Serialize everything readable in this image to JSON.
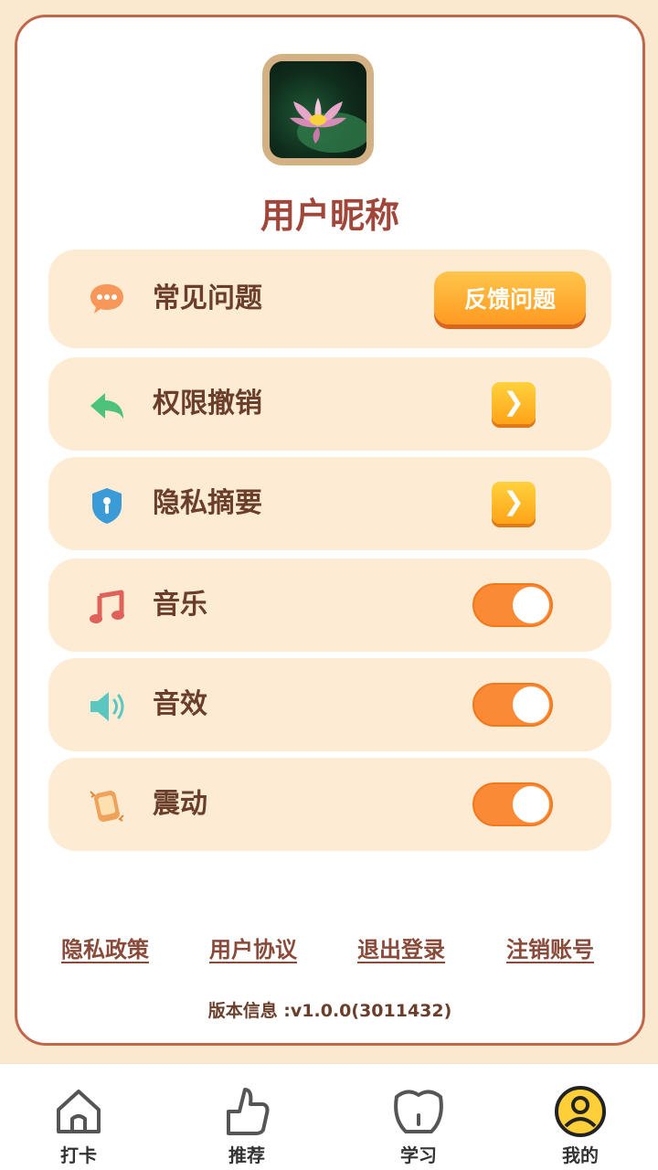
{
  "profile": {
    "nickname": "用户昵称"
  },
  "menu": {
    "faq": {
      "label": "常见问题",
      "icon": "chat-bubble-icon",
      "button_label": "反馈问题"
    },
    "permissions": {
      "label": "权限撤销",
      "icon": "back-arrow-icon"
    },
    "privacy_summary": {
      "label": "隐私摘要",
      "icon": "shield-icon"
    },
    "music": {
      "label": "音乐",
      "icon": "music-note-icon",
      "enabled": true
    },
    "sound_effects": {
      "label": "音效",
      "icon": "speaker-icon",
      "enabled": true
    },
    "vibration": {
      "label": "震动",
      "icon": "vibrating-phone-icon",
      "enabled": true
    }
  },
  "footer_links": {
    "privacy_policy": "隐私政策",
    "user_agreement": "用户协议",
    "logout": "退出登录",
    "delete_account": "注销账号"
  },
  "version_text": "版本信息 :v1.0.0(3011432)",
  "tabs": {
    "checkin": {
      "label": "打卡",
      "icon": "house-icon"
    },
    "recommend": {
      "label": "推荐",
      "icon": "thumbs-up-icon"
    },
    "study": {
      "label": "学习",
      "icon": "cup-icon"
    },
    "mine": {
      "label": "我的",
      "icon": "user-icon",
      "active": true
    }
  },
  "colors": {
    "page_background": "#fbe9cf",
    "card_border": "#c0674b",
    "row_background": "#fdecd3",
    "accent_orange": "#fb8a36",
    "title_text": "#a1463a",
    "label_text": "#6b3e2c"
  }
}
